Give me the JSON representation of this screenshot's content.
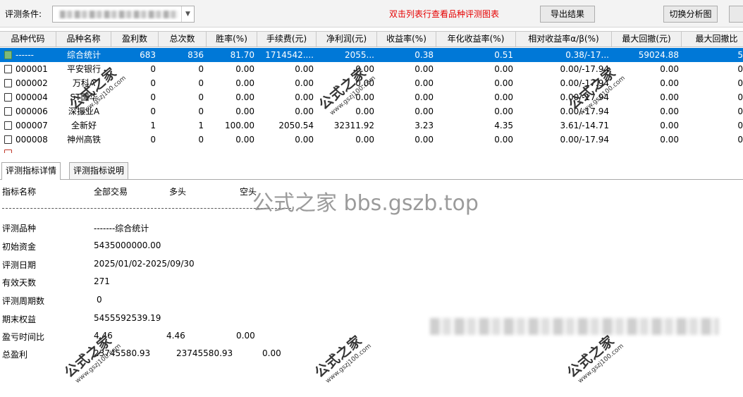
{
  "toolbar": {
    "condition_label": "评测条件:",
    "hint": "双击列表行查看品种评测图表",
    "export_label": "导出结果",
    "switch_label": "切换分析图"
  },
  "grid": {
    "columns": [
      "品种代码",
      "品种名称",
      "盈利数",
      "总次数",
      "胜率(%)",
      "手续费(元)",
      "净利润(元)",
      "收益率(%)",
      "年化收益率(%)",
      "相对收益率α/β(%)",
      "最大回撤(元)",
      "最大回撤比"
    ],
    "rows": [
      {
        "code": "------",
        "name": "综合统计",
        "profit": "683",
        "total": "836",
        "winrate": "81.70",
        "fee": "1714542....",
        "net": "2055...",
        "ret": "0.38",
        "annual": "0.51",
        "alpha": "0.38/-17...",
        "dd": "59024.88",
        "ddr": "5"
      },
      {
        "code": "000001",
        "name": "平安银行",
        "profit": "0",
        "total": "0",
        "winrate": "0.00",
        "fee": "0.00",
        "net": "0.00",
        "ret": "0.00",
        "annual": "0.00",
        "alpha": "0.00/-17.94",
        "dd": "0.00",
        "ddr": "0"
      },
      {
        "code": "000002",
        "name": "万科A",
        "profit": "0",
        "total": "0",
        "winrate": "0.00",
        "fee": "0.00",
        "net": "0.00",
        "ret": "0.00",
        "annual": "0.00",
        "alpha": "0.00/-17.94",
        "dd": "0.00",
        "ddr": "0"
      },
      {
        "code": "000004",
        "name": "ST国华",
        "profit": "0",
        "total": "0",
        "winrate": "0.00",
        "fee": "0.00",
        "net": "0.00",
        "ret": "0.00",
        "annual": "0.00",
        "alpha": "0.00/-17.94",
        "dd": "0.00",
        "ddr": "0"
      },
      {
        "code": "000006",
        "name": "深振业A",
        "profit": "0",
        "total": "0",
        "winrate": "0.00",
        "fee": "0.00",
        "net": "0.00",
        "ret": "0.00",
        "annual": "0.00",
        "alpha": "0.00/-17.94",
        "dd": "0.00",
        "ddr": "0"
      },
      {
        "code": "000007",
        "name": "全新好",
        "profit": "1",
        "total": "1",
        "winrate": "100.00",
        "fee": "2050.54",
        "net": "32311.92",
        "ret": "3.23",
        "annual": "4.35",
        "alpha": "3.61/-14.71",
        "dd": "0.00",
        "ddr": "0"
      },
      {
        "code": "000008",
        "name": "神州高铁",
        "profit": "0",
        "total": "0",
        "winrate": "0.00",
        "fee": "0.00",
        "net": "0.00",
        "ret": "0.00",
        "annual": "0.00",
        "alpha": "0.00/-17.94",
        "dd": "0.00",
        "ddr": "0"
      }
    ]
  },
  "tabs": [
    "评测指标详情",
    "评测指标说明"
  ],
  "detail": {
    "headers": [
      "指标名称",
      "全部交易",
      "多头",
      "空头"
    ],
    "rows": [
      {
        "label": "评测品种",
        "v1": "-------综合统计",
        "v2": "",
        "v3": ""
      },
      {
        "label": "初始资金",
        "v1": "5435000000.00",
        "v2": "",
        "v3": ""
      },
      {
        "label": "评测日期",
        "v1": "2025/01/02-2025/09/30",
        "v2": "",
        "v3": ""
      },
      {
        "label": "有效天数",
        "v1": "271",
        "v2": "",
        "v3": ""
      },
      {
        "label": "评测周期数",
        "v1": "0",
        "v2": "",
        "v3": ""
      },
      {
        "label": "期末权益",
        "v1": "5455592539.19",
        "v2": "",
        "v3": ""
      },
      {
        "label": "盈亏时间比",
        "v1": "4.46",
        "v2": "4.46",
        "v3": "0.00"
      },
      {
        "label": "总盈利",
        "v1": "23745580.93",
        "v2": "23745580.93",
        "v3": "0.00"
      }
    ]
  },
  "watermark": {
    "big": "公式之家 bbs.gszb.top",
    "brand": "公式之家",
    "url": "www.gszj100.com"
  }
}
